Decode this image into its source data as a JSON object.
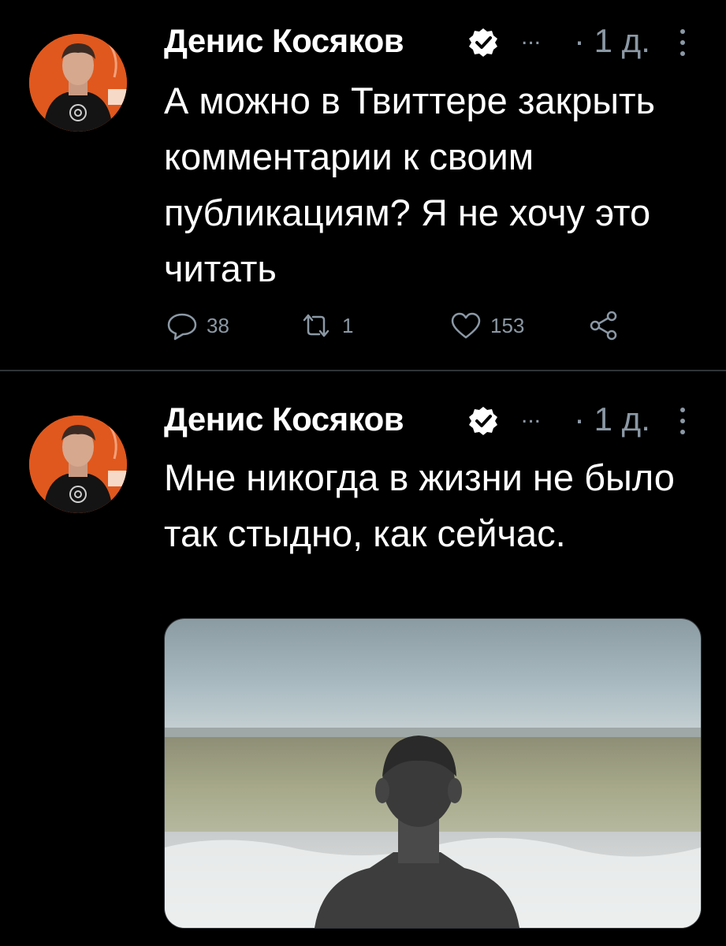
{
  "tweets": [
    {
      "author": "Денис Косяков",
      "ellipsis": "...",
      "time": "· 1 д.",
      "text": "А можно в Твиттере закрыть комментарии к своим публикациям? Я не хочу это читать",
      "replies": "38",
      "retweets": "1",
      "likes": "153"
    },
    {
      "author": "Денис Косяков",
      "ellipsis": "...",
      "time": "· 1 д.",
      "text": "Мне никогда в жизни не было так стыдно, как сейчас."
    }
  ],
  "icons": {
    "verified": "verified-badge-icon",
    "more": "more-vertical-icon",
    "reply": "reply-icon",
    "retweet": "retweet-icon",
    "like": "like-icon",
    "share": "share-icon"
  },
  "colors": {
    "background": "#000000",
    "text": "#ffffff",
    "muted": "#8b98a5",
    "avatar_bg": "#e0581d",
    "divider": "#2f3336"
  }
}
